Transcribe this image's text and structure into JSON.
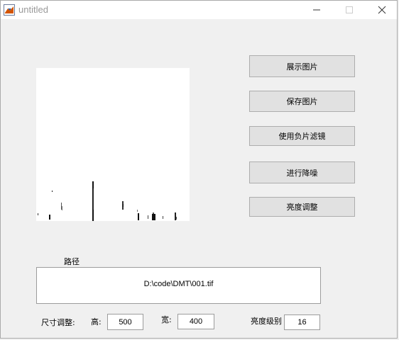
{
  "window": {
    "title": "untitled",
    "icon": "matlab-icon",
    "controls": [
      "minimize-icon",
      "maximize-icon",
      "close-icon"
    ]
  },
  "buttons": {
    "show_image": "展示图片",
    "save_image": "保存图片",
    "negative_filter": "使用负片滤镜",
    "denoise": "进行降噪",
    "brightness_adjust": "亮度调整"
  },
  "path": {
    "label": "路径",
    "value": "D:\\code\\DMT\\001.tif"
  },
  "size_adjust": {
    "label": "尺寸调整:",
    "height_label": "高:",
    "height_value": "500",
    "width_label": "宽:",
    "width_value": "400"
  },
  "brightness": {
    "label": "亮度级别",
    "value": "16"
  }
}
